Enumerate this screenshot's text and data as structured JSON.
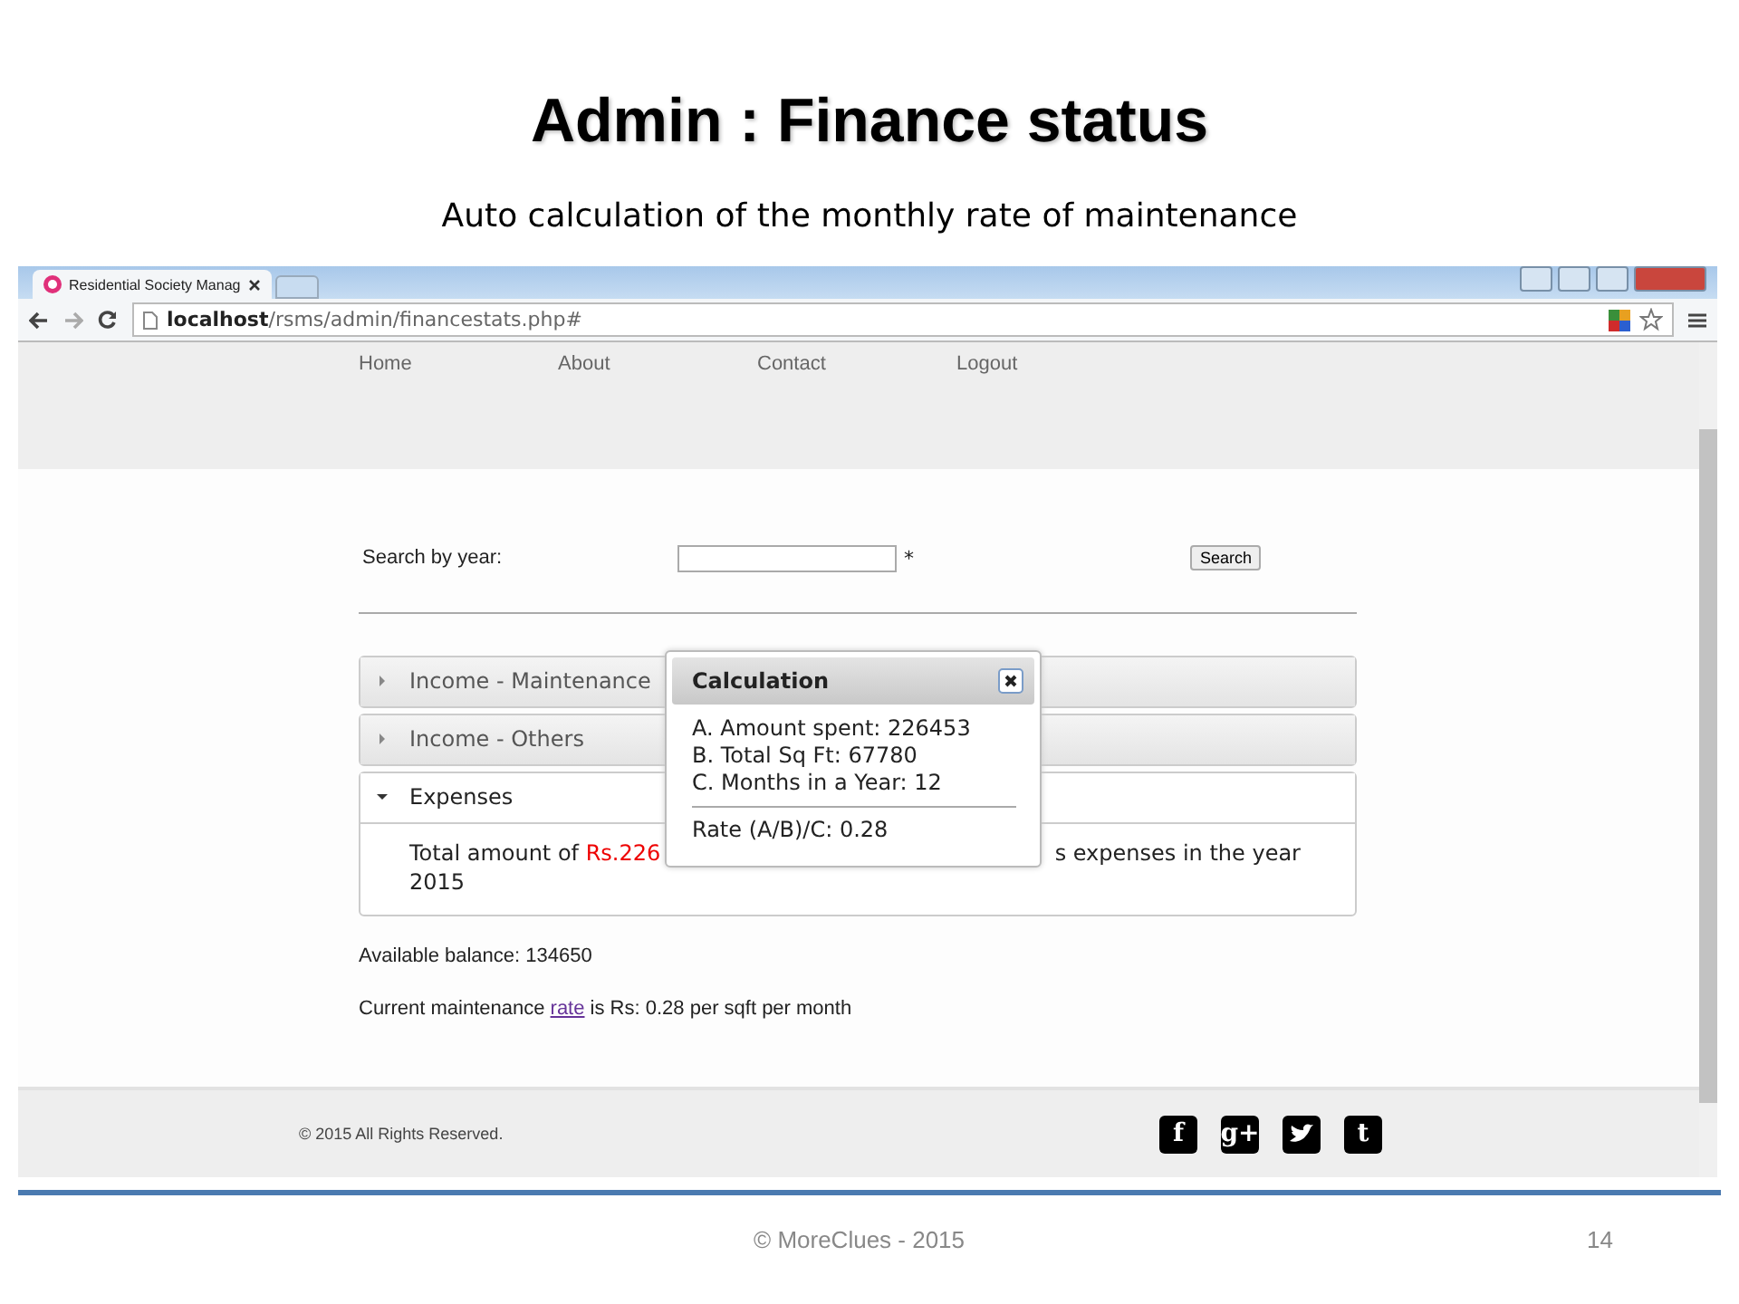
{
  "slide": {
    "title": "Admin : Finance status",
    "subtitle": "Auto calculation of the monthly rate of maintenance",
    "footer": "© MoreClues - 2015",
    "page_number": "14"
  },
  "browser": {
    "tab_title": "Residential Society Manag",
    "url_host": "localhost",
    "url_path": "/rsms/admin/financestats.php#"
  },
  "nav": [
    "Home",
    "About",
    "Contact",
    "Logout"
  ],
  "search": {
    "label": "Search by year:",
    "required_mark": "*",
    "button": "Search"
  },
  "accordion": [
    {
      "title": "Income - Maintenance",
      "expanded": false
    },
    {
      "title": "Income - Others",
      "expanded": false
    },
    {
      "title": "Expenses",
      "expanded": true,
      "body_start": "Total amount of ",
      "amount": "Rs.226",
      "body_end": "s expenses in the year",
      "body_year": "2015"
    }
  ],
  "dialog": {
    "title": "Calculation",
    "lines": [
      "A. Amount spent: 226453",
      "B. Total Sq Ft: 67780",
      "C. Months in a Year: 12"
    ],
    "result": "Rate (A/B)/C: 0.28"
  },
  "balance": "Available balance: 134650",
  "rate_line": {
    "before": "Current maintenance ",
    "link": "rate",
    "after": " is Rs: 0.28 per sqft per month"
  },
  "copyright": "© 2015 All Rights Reserved.",
  "social": [
    {
      "kind": "glyph",
      "glyph": "f"
    },
    {
      "kind": "glyph",
      "glyph": "g+"
    },
    {
      "kind": "bird"
    },
    {
      "kind": "glyph",
      "glyph": "t"
    }
  ]
}
